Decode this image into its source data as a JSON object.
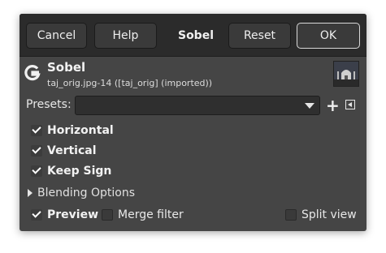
{
  "header": {
    "cancel_label": "Cancel",
    "help_label": "Help",
    "title": "Sobel",
    "reset_label": "Reset",
    "ok_label": "OK"
  },
  "filter": {
    "name": "Sobel",
    "subtitle": "taj_orig.jpg-14 ([taj_orig] (imported))"
  },
  "presets": {
    "label": "Presets:",
    "value": ""
  },
  "options": {
    "horizontal": {
      "label": "Horizontal",
      "checked": true
    },
    "vertical": {
      "label": "Vertical",
      "checked": true
    },
    "keep_sign": {
      "label": "Keep Sign",
      "checked": true
    }
  },
  "blending": {
    "label": "Blending Options"
  },
  "footer": {
    "preview": {
      "label": "Preview",
      "checked": true
    },
    "merge_filter": {
      "label": "Merge filter",
      "checked": false
    },
    "split_view": {
      "label": "Split view",
      "checked": false
    }
  },
  "icons": {
    "logo": "gimp-gegl-icon",
    "add_preset": "plus-icon",
    "preset_menu": "menu-icon",
    "expander": "triangle-right-icon"
  },
  "colors": {
    "dialog_bg": "#454545",
    "header_bg": "#2b2b2b",
    "text": "#e8e8e8"
  }
}
